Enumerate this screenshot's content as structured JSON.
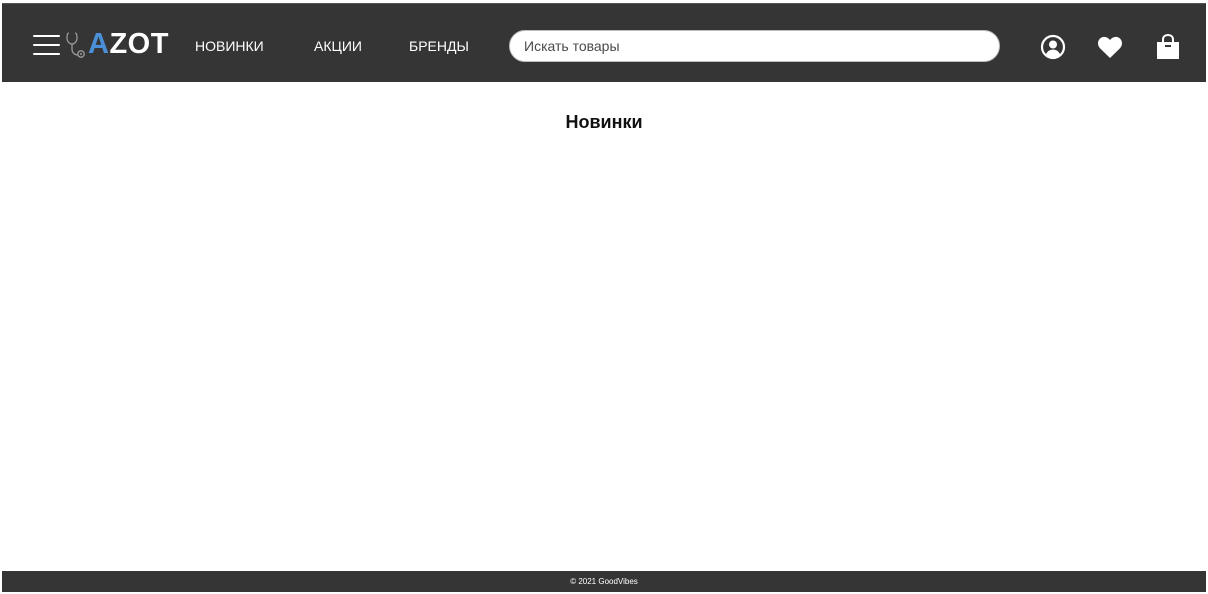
{
  "header": {
    "logo": {
      "prefix": "A",
      "rest": "ZOT"
    },
    "nav": [
      {
        "label": "НОВИНКИ"
      },
      {
        "label": "АКЦИИ"
      },
      {
        "label": "БРЕНДЫ"
      }
    ],
    "search": {
      "placeholder": "Искать товары",
      "value": ""
    },
    "icons": [
      "menu-icon",
      "user-icon",
      "heart-icon",
      "shopping-bag-icon"
    ]
  },
  "main": {
    "title": "Новинки"
  },
  "footer": {
    "copyright": "© 2021 GoodVibes"
  },
  "colors": {
    "header_bg": "#353535",
    "logo_accent": "#4a90d9",
    "text_light": "#ffffff",
    "page_bg": "#ffffff"
  }
}
